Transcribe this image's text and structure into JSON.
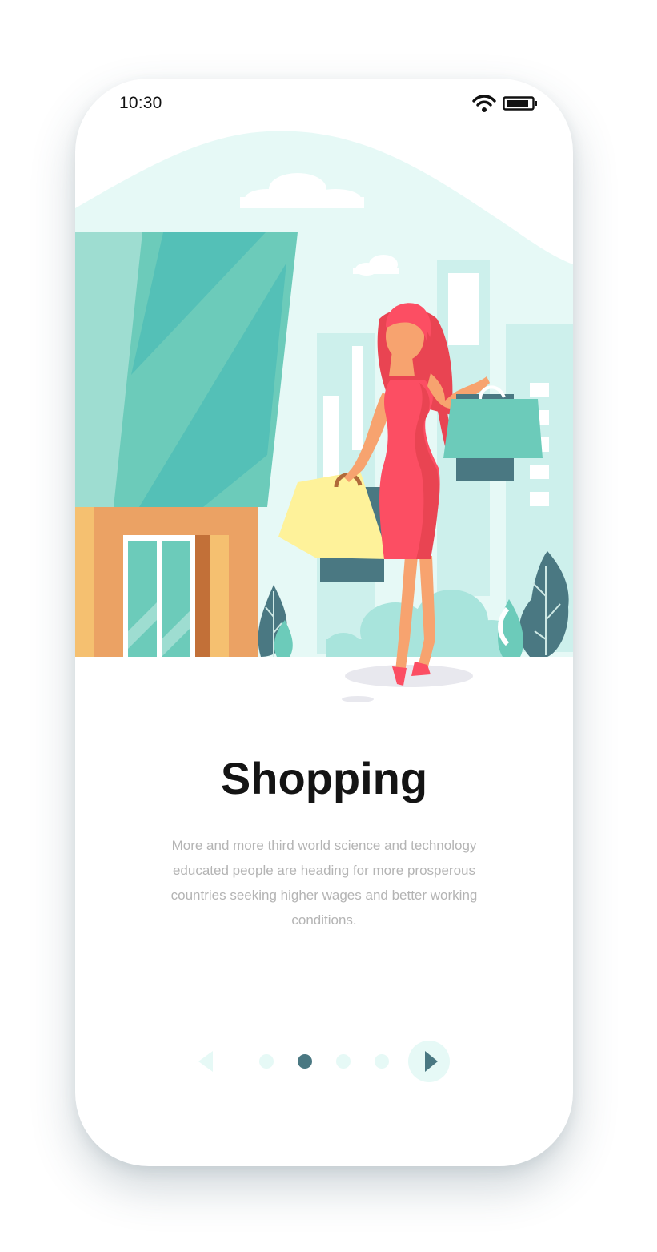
{
  "status_bar": {
    "time": "10:30",
    "icons": [
      "wifi-icon",
      "battery-icon"
    ]
  },
  "illustration": {
    "subject": "shopping-woman-illustration"
  },
  "onboarding": {
    "title": "Shopping",
    "description": "More and more third world science and technology educated people are heading for more prosperous countries seeking higher wages and better working conditions."
  },
  "pager": {
    "page_count": 4,
    "current_page": 2,
    "prev_icon": "chevron-left-icon",
    "next_icon": "chevron-right-icon"
  },
  "colors": {
    "accent": "#4a7882",
    "accent_light": "#e6f9f6",
    "teal": "#6ccbba",
    "dress": "#fc4e63",
    "title": "#141414",
    "body_text": "#b4b4b4"
  }
}
